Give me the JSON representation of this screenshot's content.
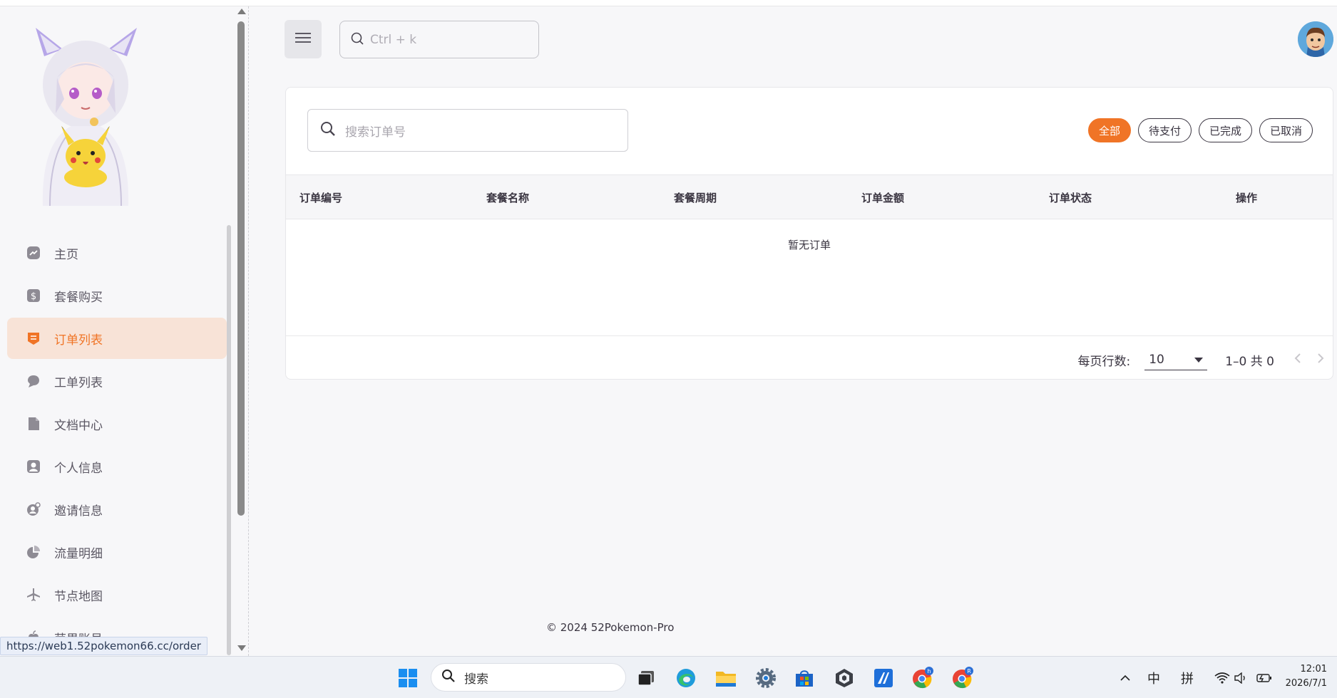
{
  "url_status": "https://web1.52pokemon66.cc/order",
  "header": {
    "search_placeholder": "Ctrl + k"
  },
  "sidebar": {
    "items": [
      {
        "label": "主页",
        "icon": "chart-line-icon",
        "active": false
      },
      {
        "label": "套餐购买",
        "icon": "dollar-icon",
        "active": false
      },
      {
        "label": "订单列表",
        "icon": "receipt-icon",
        "active": true
      },
      {
        "label": "工单列表",
        "icon": "chat-bubble-icon",
        "active": false
      },
      {
        "label": "文档中心",
        "icon": "document-icon",
        "active": false
      },
      {
        "label": "个人信息",
        "icon": "user-icon",
        "active": false
      },
      {
        "label": "邀请信息",
        "icon": "invite-icon",
        "active": false
      },
      {
        "label": "流量明细",
        "icon": "pie-chart-icon",
        "active": false
      },
      {
        "label": "节点地图",
        "icon": "airplane-icon",
        "active": false
      },
      {
        "label": "苹果账号",
        "icon": "apple-icon",
        "active": false
      }
    ]
  },
  "orders": {
    "search_placeholder": "搜索订单号",
    "filters": [
      {
        "label": "全部",
        "active": true
      },
      {
        "label": "待支付",
        "active": false
      },
      {
        "label": "已完成",
        "active": false
      },
      {
        "label": "已取消",
        "active": false
      }
    ],
    "columns": [
      "订单编号",
      "套餐名称",
      "套餐周期",
      "订单金额",
      "订单状态",
      "操作"
    ],
    "empty_text": "暂无订单",
    "pager": {
      "rows_label": "每页行数:",
      "rows_value": "10",
      "range": "1–0 共 0"
    }
  },
  "footer": "© 2024 52Pokemon-Pro",
  "taskbar": {
    "search_placeholder": "搜索",
    "ime_lang": "中",
    "ime_mode": "拼",
    "time": "12:01",
    "date": "2026/7/1"
  },
  "colors": {
    "accent": "#f07426",
    "active_bg": "#f8e3d7",
    "text": "#3a3541"
  }
}
